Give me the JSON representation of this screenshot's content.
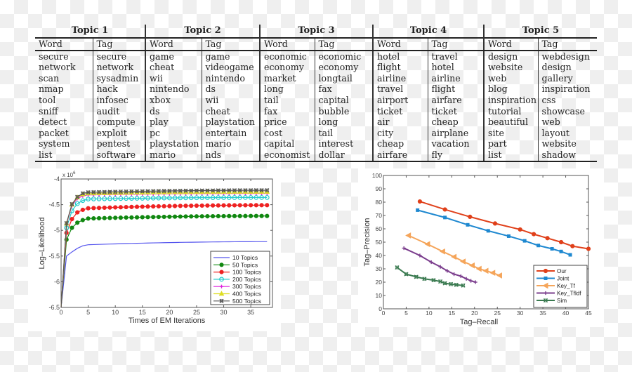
{
  "table": {
    "topics": [
      {
        "title": "Topic 1",
        "word_header": "Word",
        "tag_header": "Tag",
        "words": [
          "secure",
          "network",
          "scan",
          "nmap",
          "tool",
          "sniff",
          "detect",
          "packet",
          "system",
          "list"
        ],
        "tags": [
          "secure",
          "network",
          "sysadmin",
          "hack",
          "infosec",
          "audit",
          "compute",
          "exploit",
          "pentest",
          "software"
        ]
      },
      {
        "title": "Topic 2",
        "word_header": "Word",
        "tag_header": "Tag",
        "words": [
          "game",
          "cheat",
          "wii",
          "nintendo",
          "xbox",
          "ds",
          "play",
          "pc",
          "playstation",
          "mario"
        ],
        "tags": [
          "game",
          "videogame",
          "nintendo",
          "ds",
          "wii",
          "cheat",
          "playstation",
          "entertain",
          "mario",
          "nds"
        ]
      },
      {
        "title": "Topic 3",
        "word_header": "Word",
        "tag_header": "Tag",
        "words": [
          "economic",
          "economy",
          "market",
          "long",
          "tail",
          "fax",
          "price",
          "cost",
          "capital",
          "economist"
        ],
        "tags": [
          "economic",
          "economy",
          "longtail",
          "fax",
          "capital",
          "bubble",
          "long",
          "tail",
          "interest",
          "dollar"
        ]
      },
      {
        "title": "Topic 4",
        "word_header": "Word",
        "tag_header": "Tag",
        "words": [
          "hotel",
          "flight",
          "airline",
          "travel",
          "airport",
          "ticket",
          "air",
          "city",
          "cheap",
          "airfare"
        ],
        "tags": [
          "travel",
          "hotel",
          "airline",
          "flight",
          "airfare",
          "ticket",
          "cheap",
          "airplane",
          "vacation",
          "fly"
        ]
      },
      {
        "title": "Topic 5",
        "word_header": "Word",
        "tag_header": "Tag",
        "words": [
          "design",
          "website",
          "web",
          "blog",
          "inspiration",
          "tutorial",
          "beautiful",
          "site",
          "part",
          "list"
        ],
        "tags": [
          "webdesign",
          "design",
          "gallery",
          "inspiration",
          "css",
          "showcase",
          "web",
          "layout",
          "website",
          "shadow"
        ]
      }
    ]
  },
  "chart_data": [
    {
      "type": "line",
      "title": "",
      "xlabel": "Times of EM Iterations",
      "ylabel": "Log–Likelihood",
      "y_multiplier_label": "x 10",
      "y_multiplier_exp": "6",
      "xlim": [
        0,
        39
      ],
      "ylim": [
        -6.5,
        -4
      ],
      "xticks": [
        0,
        5,
        10,
        15,
        20,
        25,
        30,
        35
      ],
      "yticks": [
        -6.5,
        -6,
        -5.5,
        -5,
        -4.5,
        -4
      ],
      "ytick_labels": [
        "-6.5",
        "-6",
        "-5.5",
        "-5",
        "-4.5",
        "-4"
      ],
      "legend_position": "bottom-right",
      "grid": false,
      "x": [
        0,
        1,
        2,
        3,
        4,
        5,
        6,
        7,
        8,
        9,
        10,
        11,
        12,
        13,
        14,
        15,
        16,
        17,
        18,
        19,
        20,
        21,
        22,
        23,
        24,
        25,
        26,
        27,
        28,
        29,
        30,
        31,
        32,
        33,
        34,
        35,
        36,
        37,
        38
      ],
      "series": [
        {
          "name": "10 Topics",
          "color": "#5555ee",
          "marker": "none",
          "start": -6.5,
          "p1": -5.5,
          "p2": -5.42,
          "p3": -5.35,
          "p4": -5.3,
          "plateau_start": -5.28,
          "plateau_end": -5.22
        },
        {
          "name": "50 Topics",
          "color": "#118811",
          "marker": "dot",
          "start": -6.5,
          "p1": -5.18,
          "p2": -4.95,
          "p3": -4.85,
          "p4": -4.8,
          "plateau_start": -4.77,
          "plateau_end": -4.72
        },
        {
          "name": "100 Topics",
          "color": "#ee2222",
          "marker": "dot",
          "start": -6.5,
          "p1": -5.05,
          "p2": -4.78,
          "p3": -4.65,
          "p4": -4.6,
          "plateau_start": -4.57,
          "plateau_end": -4.51
        },
        {
          "name": "200 Topics",
          "color": "#22cccc",
          "marker": "circle",
          "start": -6.5,
          "p1": -4.95,
          "p2": -4.62,
          "p3": -4.48,
          "p4": -4.42,
          "plateau_start": -4.39,
          "plateau_end": -4.36
        },
        {
          "name": "300 Topics",
          "color": "#dd22dd",
          "marker": "plus",
          "start": -6.5,
          "p1": -4.88,
          "p2": -4.52,
          "p3": -4.38,
          "p4": -4.33,
          "plateau_start": -4.31,
          "plateau_end": -4.28
        },
        {
          "name": "400 Topics",
          "color": "#dddd22",
          "marker": "triangle",
          "start": -6.5,
          "p1": -4.87,
          "p2": -4.5,
          "p3": -4.36,
          "p4": -4.3,
          "plateau_start": -4.28,
          "plateau_end": -4.25
        },
        {
          "name": "500 Topics",
          "color": "#555555",
          "marker": "x",
          "start": -6.5,
          "p1": -4.86,
          "p2": -4.49,
          "p3": -4.35,
          "p4": -4.28,
          "plateau_start": -4.26,
          "plateau_end": -4.22
        }
      ]
    },
    {
      "type": "line",
      "title": "",
      "xlabel": "Tag–Recall",
      "ylabel": "Tag–Precision",
      "xlim": [
        0,
        45
      ],
      "ylim": [
        0,
        100
      ],
      "xticks": [
        0,
        5,
        10,
        15,
        20,
        25,
        30,
        35,
        40,
        45
      ],
      "yticks": [
        0,
        10,
        20,
        30,
        40,
        50,
        60,
        70,
        80,
        90,
        100
      ],
      "legend_position": "bottom-right",
      "grid": false,
      "series": [
        {
          "name": "Our",
          "color": "#e0401a",
          "marker": "dot",
          "points": [
            [
              8,
              80.5
            ],
            [
              13.5,
              74.5
            ],
            [
              19,
              69
            ],
            [
              24.5,
              64
            ],
            [
              30,
              59.5
            ],
            [
              33,
              56
            ],
            [
              36,
              53
            ],
            [
              39,
              50
            ],
            [
              41.5,
              47
            ],
            [
              45,
              45
            ]
          ]
        },
        {
          "name": "Joint",
          "color": "#1e88d0",
          "marker": "square",
          "points": [
            [
              7.5,
              74
            ],
            [
              13.5,
              68.5
            ],
            [
              18.5,
              63
            ],
            [
              23,
              58.5
            ],
            [
              27.5,
              54.5
            ],
            [
              31,
              51
            ],
            [
              34,
              47.5
            ],
            [
              37,
              45
            ],
            [
              39,
              43
            ],
            [
              41,
              40.5
            ]
          ]
        },
        {
          "name": "Key_Tf",
          "color": "#f5a55a",
          "marker": "triangle",
          "points": [
            [
              5.5,
              55
            ],
            [
              9.7,
              48.5
            ],
            [
              13,
              43
            ],
            [
              15.5,
              39
            ],
            [
              17.5,
              35.5
            ],
            [
              19.5,
              32.5
            ],
            [
              21,
              30
            ],
            [
              22.5,
              28.5
            ],
            [
              24,
              27
            ],
            [
              25.5,
              25
            ]
          ]
        },
        {
          "name": "Key_Tfldf",
          "color": "#7a3c8c",
          "marker": "plus",
          "points": [
            [
              4.5,
              45.5
            ],
            [
              8,
              40
            ],
            [
              10.5,
              35
            ],
            [
              12.5,
              31.5
            ],
            [
              14,
              28.5
            ],
            [
              15.5,
              26
            ],
            [
              17,
              24.5
            ],
            [
              18.2,
              22.5
            ],
            [
              19.2,
              21
            ],
            [
              20.2,
              20
            ]
          ]
        },
        {
          "name": "Sim",
          "color": "#3a7a50",
          "marker": "x",
          "points": [
            [
              3,
              31
            ],
            [
              5,
              26
            ],
            [
              7.2,
              24
            ],
            [
              9,
              22.5
            ],
            [
              11,
              21.5
            ],
            [
              12.5,
              20.5
            ],
            [
              13.5,
              19.2
            ],
            [
              14.8,
              18.5
            ],
            [
              16,
              18
            ],
            [
              17.5,
              17.5
            ]
          ]
        }
      ]
    }
  ]
}
